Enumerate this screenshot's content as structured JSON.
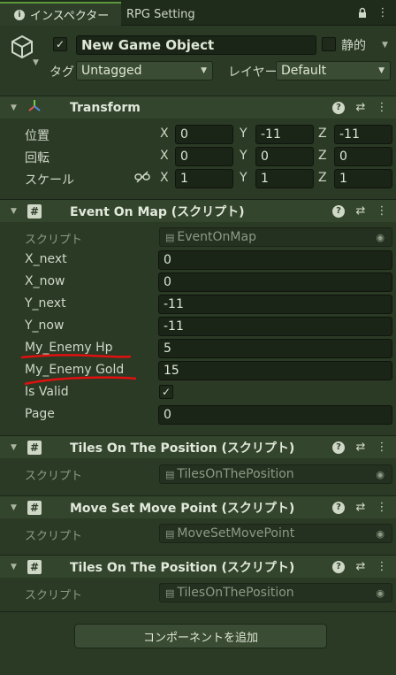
{
  "tabs": [
    {
      "label": "インスペクター",
      "active": true
    },
    {
      "label": "RPG Setting",
      "active": false
    }
  ],
  "header": {
    "object_name": "New Game Object",
    "active_checked": true,
    "static_label": "静的",
    "tag_label": "タグ",
    "tag_value": "Untagged",
    "layer_label": "レイヤー",
    "layer_value": "Default"
  },
  "transform": {
    "title": "Transform",
    "rows": [
      {
        "label": "位置",
        "x": "0",
        "y": "-11",
        "z": "-11"
      },
      {
        "label": "回転",
        "x": "0",
        "y": "0",
        "z": "0"
      },
      {
        "label": "スケール",
        "x": "1",
        "y": "1",
        "z": "1"
      }
    ],
    "axis": {
      "x": "X",
      "y": "Y",
      "z": "Z"
    }
  },
  "event_on_map": {
    "title": "Event On Map (スクリプト)",
    "script_label": "スクリプト",
    "script_value": "EventOnMap",
    "fields": [
      {
        "label": "X_next",
        "value": "0"
      },
      {
        "label": "X_now",
        "value": "0"
      },
      {
        "label": "Y_next",
        "value": "-11"
      },
      {
        "label": "Y_now",
        "value": "-11"
      },
      {
        "label": "My_Enemy Hp",
        "value": "5"
      },
      {
        "label": "My_Enemy Gold",
        "value": "15"
      },
      {
        "label": "Is Valid",
        "value": "✓"
      },
      {
        "label": "Page",
        "value": "0"
      }
    ]
  },
  "components": [
    {
      "title": "Tiles On The Position (スクリプト)",
      "script_label": "スクリプト",
      "script_value": "TilesOnThePosition"
    },
    {
      "title": "Move Set Move Point (スクリプト)",
      "script_label": "スクリプト",
      "script_value": "MoveSetMovePoint"
    },
    {
      "title": "Tiles On The Position (スクリプト)",
      "script_label": "スクリプト",
      "script_value": "TilesOnThePosition"
    }
  ],
  "add_component_label": "コンポーネントを追加",
  "colors": {
    "accent": "#5a9a3c",
    "annotation": "#e01010",
    "background": "#2b3a25"
  }
}
